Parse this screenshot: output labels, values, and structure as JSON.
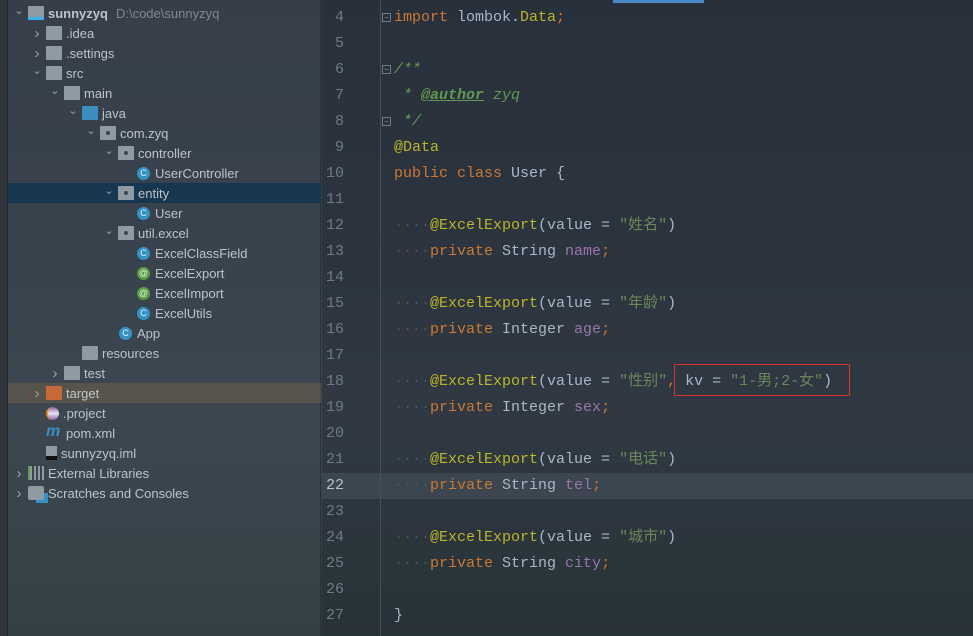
{
  "tree": [
    {
      "label": "sunnyzyq",
      "hint": "D:\\code\\sunnyzyq",
      "depth": 0,
      "chev": "open",
      "icon": "module",
      "bold": true
    },
    {
      "label": ".idea",
      "depth": 1,
      "chev": "closed",
      "icon": "folder"
    },
    {
      "label": ".settings",
      "depth": 1,
      "chev": "closed",
      "icon": "folder"
    },
    {
      "label": "src",
      "depth": 1,
      "chev": "open",
      "icon": "folder"
    },
    {
      "label": "main",
      "depth": 2,
      "chev": "open",
      "icon": "folder"
    },
    {
      "label": "java",
      "depth": 3,
      "chev": "open",
      "icon": "folder-blue"
    },
    {
      "label": "com.zyq",
      "depth": 4,
      "chev": "open",
      "icon": "package"
    },
    {
      "label": "controller",
      "depth": 5,
      "chev": "open",
      "icon": "package"
    },
    {
      "label": "UserController",
      "depth": 6,
      "chev": "none",
      "icon": "class"
    },
    {
      "label": "entity",
      "depth": 5,
      "chev": "open",
      "icon": "package",
      "selected": true
    },
    {
      "label": "User",
      "depth": 6,
      "chev": "none",
      "icon": "class"
    },
    {
      "label": "util.excel",
      "depth": 5,
      "chev": "open",
      "icon": "package"
    },
    {
      "label": "ExcelClassField",
      "depth": 6,
      "chev": "none",
      "icon": "class"
    },
    {
      "label": "ExcelExport",
      "depth": 6,
      "chev": "none",
      "icon": "annotation"
    },
    {
      "label": "ExcelImport",
      "depth": 6,
      "chev": "none",
      "icon": "annotation"
    },
    {
      "label": "ExcelUtils",
      "depth": 6,
      "chev": "none",
      "icon": "class"
    },
    {
      "label": "App",
      "depth": 5,
      "chev": "none",
      "icon": "class"
    },
    {
      "label": "resources",
      "depth": 3,
      "chev": "none",
      "icon": "folder"
    },
    {
      "label": "test",
      "depth": 2,
      "chev": "closed",
      "icon": "folder"
    },
    {
      "label": "target",
      "depth": 1,
      "chev": "closed",
      "icon": "folder-orange",
      "target": true
    },
    {
      "label": ".project",
      "depth": 1,
      "chev": "none",
      "icon": "eclipse"
    },
    {
      "label": "pom.xml",
      "depth": 1,
      "chev": "none",
      "icon": "maven"
    },
    {
      "label": "sunnyzyq.iml",
      "depth": 1,
      "chev": "none",
      "icon": "file"
    },
    {
      "label": "External Libraries",
      "depth": 0,
      "chev": "closed",
      "icon": "libraries"
    },
    {
      "label": "Scratches and Consoles",
      "depth": 0,
      "chev": "closed",
      "icon": "scratches"
    }
  ],
  "code": {
    "current_line": 22,
    "lines": [
      {
        "n": "4",
        "t": [
          [
            "import",
            "k"
          ],
          [
            " ",
            "ws"
          ],
          [
            "lombok.",
            "id"
          ],
          [
            "Data",
            "ty"
          ],
          [
            ";",
            "k"
          ]
        ]
      },
      {
        "n": "5",
        "t": []
      },
      {
        "n": "6",
        "t": [
          [
            "/**",
            "c"
          ]
        ]
      },
      {
        "n": "7",
        "t": [
          [
            " * ",
            "c"
          ],
          [
            "@author",
            "tag"
          ],
          [
            " zyq",
            "c"
          ]
        ]
      },
      {
        "n": "8",
        "t": [
          [
            " */",
            "c"
          ]
        ]
      },
      {
        "n": "9",
        "t": [
          [
            "@Data",
            "an"
          ]
        ]
      },
      {
        "n": "10",
        "t": [
          [
            "public",
            "k"
          ],
          [
            " ",
            "ws"
          ],
          [
            "class",
            "k"
          ],
          [
            " User {",
            "id"
          ]
        ]
      },
      {
        "n": "11",
        "t": []
      },
      {
        "n": "12",
        "t": [
          [
            "····",
            "ws"
          ],
          [
            "@ExcelExport",
            "an"
          ],
          [
            "(value = ",
            "id"
          ],
          [
            "\"姓名\"",
            "s"
          ],
          [
            ")",
            "id"
          ]
        ]
      },
      {
        "n": "13",
        "t": [
          [
            "····",
            "ws"
          ],
          [
            "private",
            "k"
          ],
          [
            " String ",
            "id"
          ],
          [
            "name",
            "f"
          ],
          [
            ";",
            "k"
          ]
        ]
      },
      {
        "n": "14",
        "t": []
      },
      {
        "n": "15",
        "t": [
          [
            "····",
            "ws"
          ],
          [
            "@ExcelExport",
            "an"
          ],
          [
            "(value = ",
            "id"
          ],
          [
            "\"年龄\"",
            "s"
          ],
          [
            ")",
            "id"
          ]
        ]
      },
      {
        "n": "16",
        "t": [
          [
            "····",
            "ws"
          ],
          [
            "private",
            "k"
          ],
          [
            " Integer ",
            "id"
          ],
          [
            "age",
            "f"
          ],
          [
            ";",
            "k"
          ]
        ]
      },
      {
        "n": "17",
        "t": []
      },
      {
        "n": "18",
        "t": [
          [
            "····",
            "ws"
          ],
          [
            "@ExcelExport",
            "an"
          ],
          [
            "(value = ",
            "id"
          ],
          [
            "\"性别\"",
            "s"
          ],
          [
            ", ",
            "k"
          ],
          [
            "kv = ",
            "id"
          ],
          [
            "\"1-男;2-女\"",
            "s"
          ],
          [
            ")",
            "id"
          ]
        ]
      },
      {
        "n": "19",
        "t": [
          [
            "····",
            "ws"
          ],
          [
            "private",
            "k"
          ],
          [
            " Integer ",
            "id"
          ],
          [
            "sex",
            "f"
          ],
          [
            ";",
            "k"
          ]
        ]
      },
      {
        "n": "20",
        "t": []
      },
      {
        "n": "21",
        "t": [
          [
            "····",
            "ws"
          ],
          [
            "@ExcelExport",
            "an"
          ],
          [
            "(value = ",
            "id"
          ],
          [
            "\"电话\"",
            "s"
          ],
          [
            ")",
            "id"
          ]
        ]
      },
      {
        "n": "22",
        "t": [
          [
            "····",
            "ws"
          ],
          [
            "private",
            "k"
          ],
          [
            " String ",
            "id"
          ],
          [
            "tel",
            "f"
          ],
          [
            ";",
            "k"
          ]
        ]
      },
      {
        "n": "23",
        "t": []
      },
      {
        "n": "24",
        "t": [
          [
            "····",
            "ws"
          ],
          [
            "@ExcelExport",
            "an"
          ],
          [
            "(value = ",
            "id"
          ],
          [
            "\"城市\"",
            "s"
          ],
          [
            ")",
            "id"
          ]
        ]
      },
      {
        "n": "25",
        "t": [
          [
            "····",
            "ws"
          ],
          [
            "private",
            "k"
          ],
          [
            " String ",
            "id"
          ],
          [
            "city",
            "f"
          ],
          [
            ";",
            "k"
          ]
        ]
      },
      {
        "n": "26",
        "t": []
      },
      {
        "n": "27",
        "t": [
          [
            "}",
            "id"
          ]
        ]
      }
    ]
  }
}
